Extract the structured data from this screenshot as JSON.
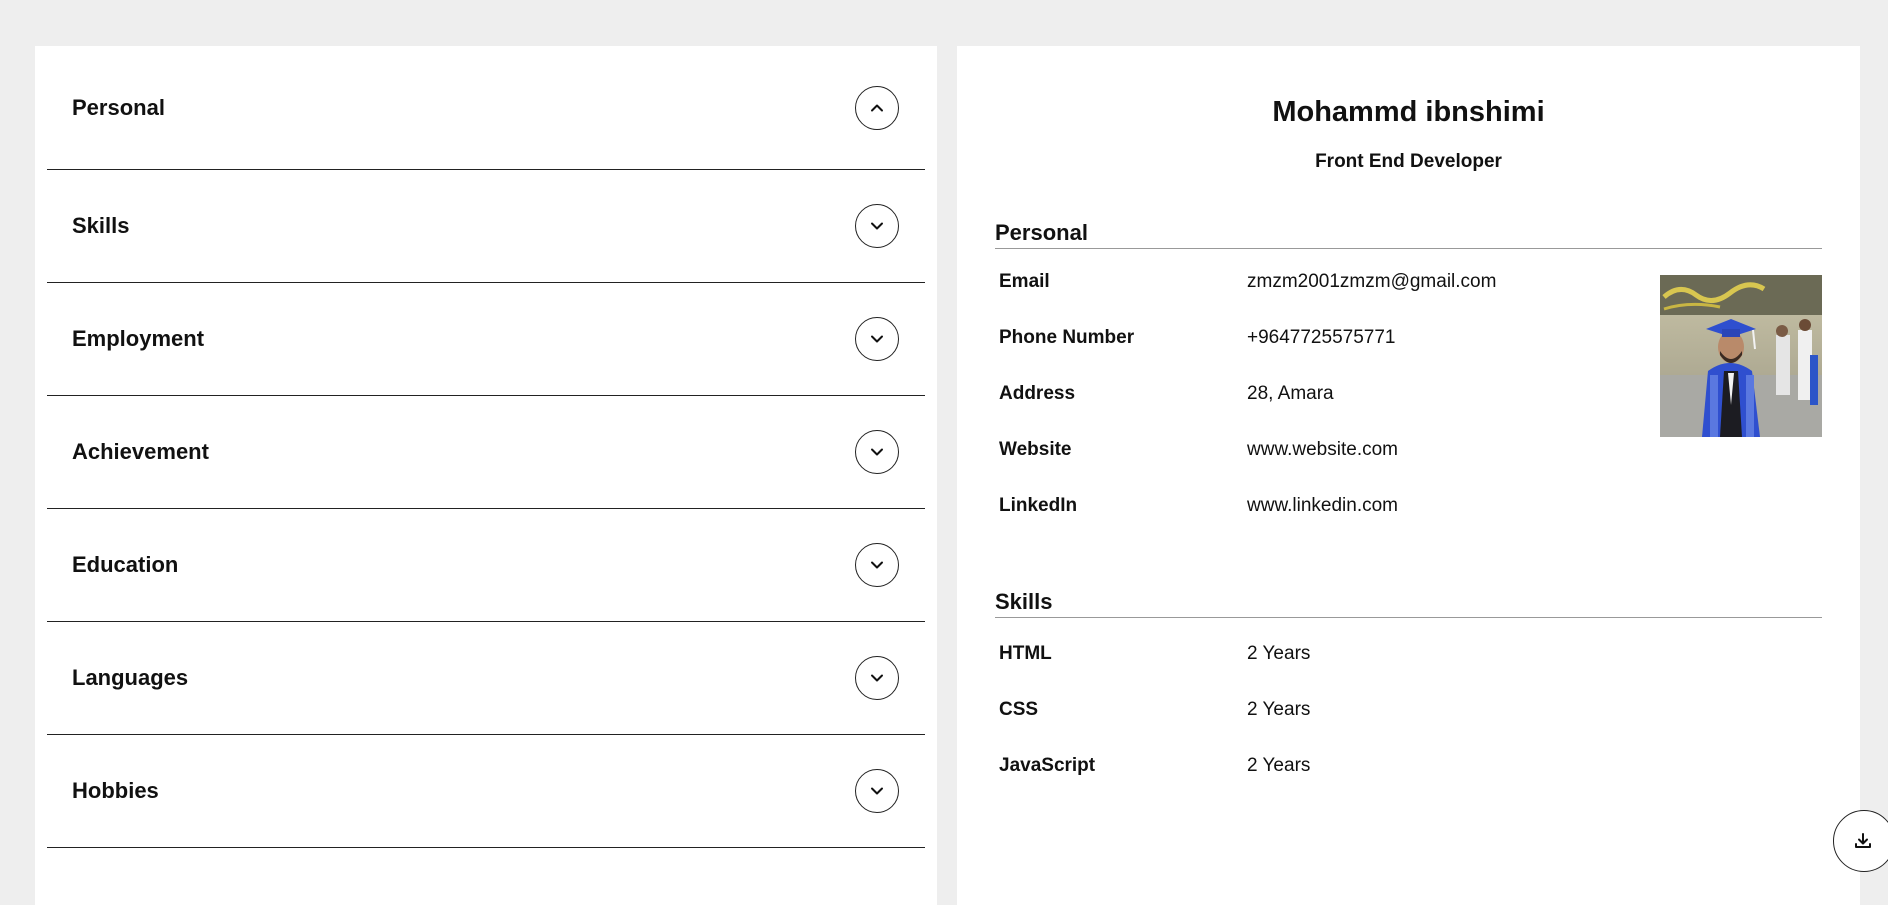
{
  "accordion": {
    "items": [
      {
        "label": "Personal",
        "expanded": true
      },
      {
        "label": "Skills",
        "expanded": false
      },
      {
        "label": "Employment",
        "expanded": false
      },
      {
        "label": "Achievement",
        "expanded": false
      },
      {
        "label": "Education",
        "expanded": false
      },
      {
        "label": "Languages",
        "expanded": false
      },
      {
        "label": "Hobbies",
        "expanded": false
      }
    ],
    "icons": {
      "expanded": "chevron-up-icon",
      "collapsed": "chevron-down-icon"
    }
  },
  "resume": {
    "name": "Mohammd ibnshimi",
    "role": "Front End Developer",
    "personal": {
      "heading": "Personal",
      "rows": [
        {
          "label": "Email",
          "value": "zmzm2001zmzm@gmail.com"
        },
        {
          "label": "Phone Number",
          "value": "+9647725575771"
        },
        {
          "label": "Address",
          "value": "28, Amara"
        },
        {
          "label": "Website",
          "value": "www.website.com"
        },
        {
          "label": "LinkedIn",
          "value": "www.linkedin.com"
        }
      ],
      "photo_icon": "profile-photo"
    },
    "skills": {
      "heading": "Skills",
      "rows": [
        {
          "label": "HTML",
          "value": "2 Years"
        },
        {
          "label": "CSS",
          "value": "2 Years"
        },
        {
          "label": "JavaScript",
          "value": "2 Years"
        }
      ]
    }
  },
  "download": {
    "icon": "download-icon"
  },
  "colors": {
    "background": "#eeeeee",
    "panel": "#ffffff",
    "text": "#111111",
    "divider": "#222222",
    "gown_blue": "#2f4fcf"
  }
}
